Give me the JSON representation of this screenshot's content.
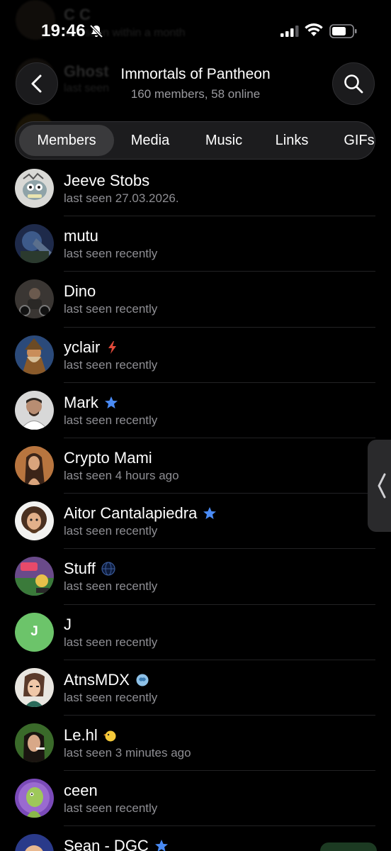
{
  "status_bar": {
    "time": "19:46"
  },
  "background_ghost": {
    "rows": [
      {
        "name": "C C",
        "sub": "last seen within a month"
      },
      {
        "name": "Ghost",
        "sub": "last seen"
      },
      {
        "name": "",
        "sub": ""
      }
    ]
  },
  "header": {
    "title": "Immortals of Pantheon",
    "subtitle": "160 members, 58 online"
  },
  "tabs": [
    {
      "label": "Members",
      "active": true
    },
    {
      "label": "Media",
      "active": false
    },
    {
      "label": "Music",
      "active": false
    },
    {
      "label": "Links",
      "active": false
    },
    {
      "label": "GIFs",
      "active": false
    }
  ],
  "members": [
    {
      "name": "Jeeve Stobs",
      "status": "last seen 27.03.2026.",
      "badge": "",
      "avatar_icon": "cartoon-fish-avatar"
    },
    {
      "name": "mutu",
      "status": "last seen recently",
      "badge": "",
      "avatar_icon": "photo-avatar"
    },
    {
      "name": "Dino",
      "status": "last seen recently",
      "badge": "",
      "avatar_icon": "photo-avatar"
    },
    {
      "name": "yclair",
      "status": "last seen recently",
      "badge": "lightning-badge-icon",
      "avatar_icon": "dwarf-avatar"
    },
    {
      "name": "Mark",
      "status": "last seen recently",
      "badge": "premium-star-icon",
      "avatar_icon": "photo-avatar"
    },
    {
      "name": "Crypto Mami",
      "status": "last seen 4 hours ago",
      "badge": "",
      "avatar_icon": "photo-avatar"
    },
    {
      "name": "Aitor Cantalapiedra",
      "status": "last seen recently",
      "badge": "premium-star-icon",
      "avatar_icon": "painter-avatar"
    },
    {
      "name": "Stuff",
      "status": "last seen recently",
      "badge": "globe-badge-icon",
      "avatar_icon": "game-avatar"
    },
    {
      "name": "J",
      "status": "last seen recently",
      "badge": "",
      "avatar_icon": "letter-avatar",
      "letter": "J"
    },
    {
      "name": "AtnsMDX",
      "status": "last seen recently",
      "badge": "brain-badge-icon",
      "avatar_icon": "drawn-avatar"
    },
    {
      "name": "Le.hl",
      "status": "last seen 3 minutes ago",
      "badge": "duck-badge-icon",
      "avatar_icon": "photo-avatar"
    },
    {
      "name": "ceen",
      "status": "last seen recently",
      "badge": "",
      "avatar_icon": "lizard-avatar"
    },
    {
      "name": "Sean - DGC",
      "status": "",
      "badge": "premium-star-icon",
      "avatar_icon": "photo-avatar"
    }
  ],
  "colors": {
    "background": "#000000",
    "secondary_text": "#8e8e93",
    "premium_star": "#4a8bf5",
    "letter_avatar": "#6cc46a"
  }
}
